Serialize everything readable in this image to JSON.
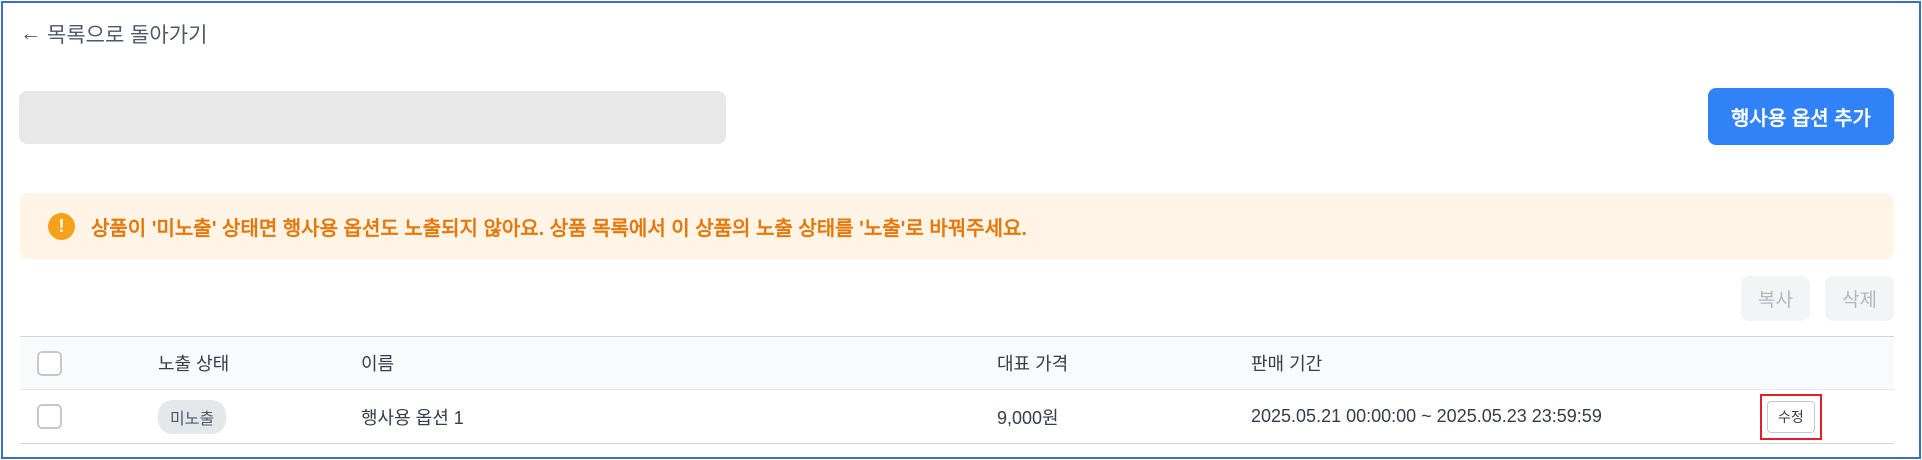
{
  "nav": {
    "back_label": "목록으로 돌아가기"
  },
  "toolbar": {
    "add_option_label": "행사용 옵션 추가"
  },
  "notice": {
    "message": "상품이 '미노출' 상태면 행사용 옵션도 노출되지 않아요. 상품 목록에서 이 상품의 노출 상태를 '노출'로 바꿔주세요."
  },
  "actions": {
    "copy_label": "복사",
    "delete_label": "삭제"
  },
  "table": {
    "headers": {
      "status": "노출 상태",
      "name": "이름",
      "price": "대표 가격",
      "period": "판매 기간"
    },
    "rows": [
      {
        "status": "미노출",
        "name": "행사용 옵션 1",
        "price": "9,000원",
        "period": "2025.05.21 00:00:00 ~ 2025.05.23 23:59:59",
        "edit_label": "수정"
      }
    ]
  },
  "colors": {
    "primary": "#3182f6",
    "warning_bg": "#fff4e5",
    "warning_text": "#e5780b",
    "warning_icon": "#f7a11a",
    "highlight_border": "#e0202a"
  },
  "icons": {
    "back": "arrow-left-icon",
    "warning": "exclamation-circle-icon"
  }
}
